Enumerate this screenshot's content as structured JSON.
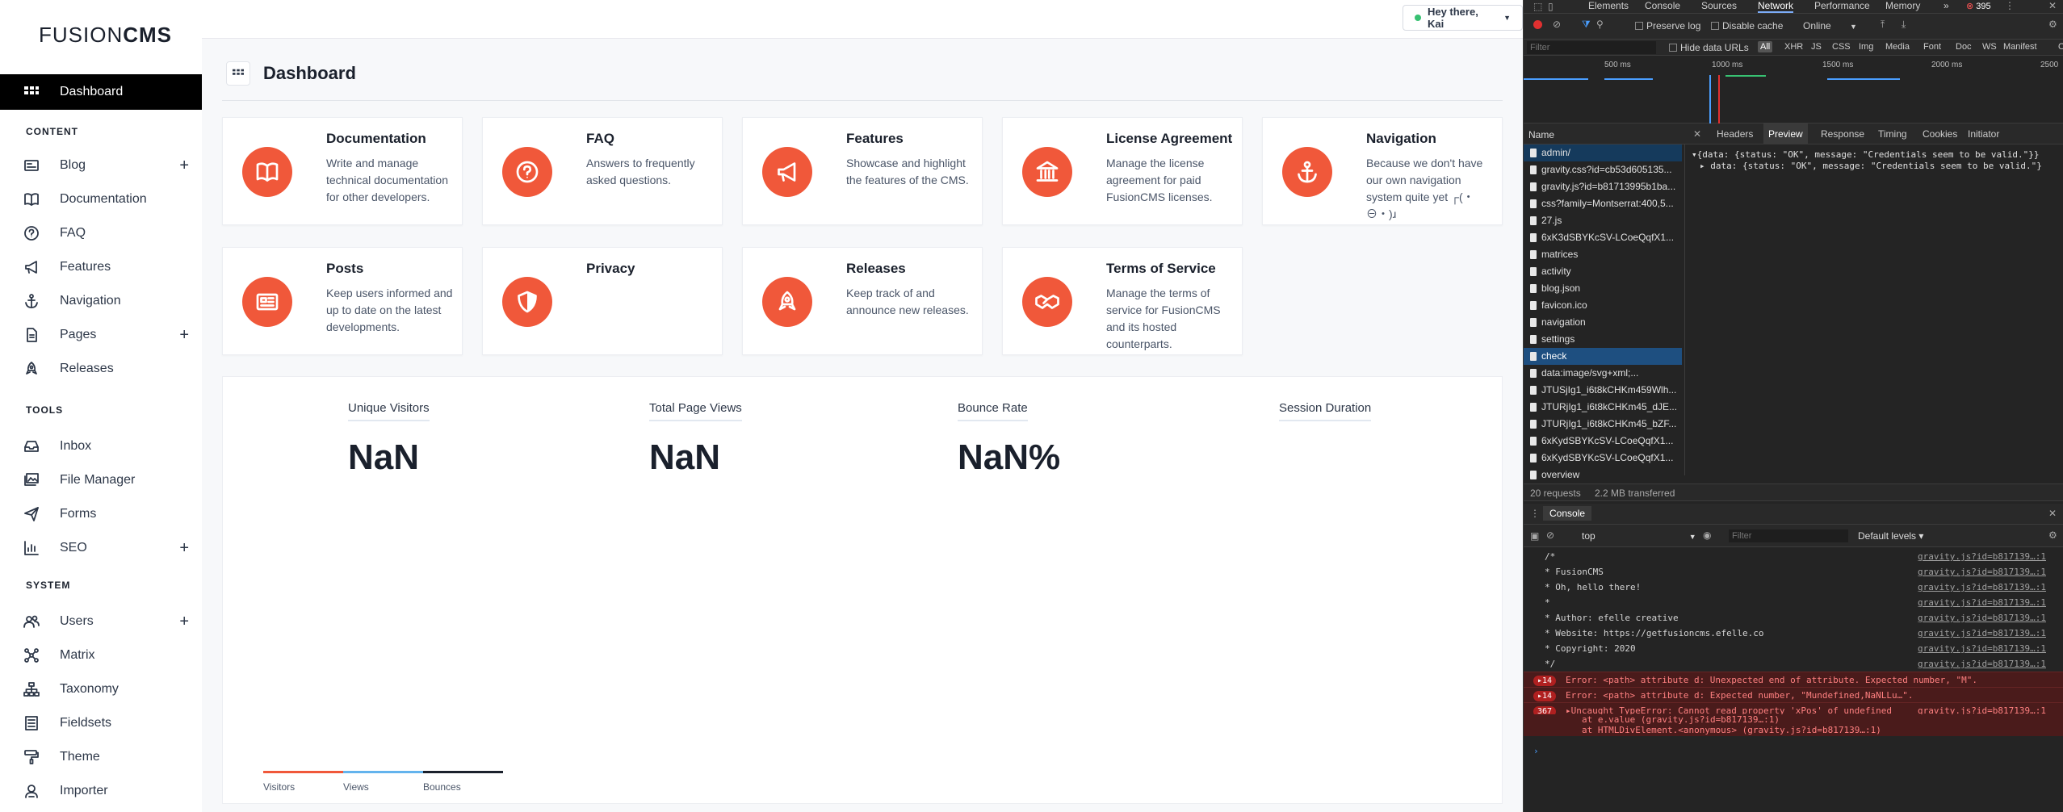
{
  "brand": {
    "part1": "FUSION",
    "part2": "CMS"
  },
  "sidebar": {
    "dashboard": "Dashboard",
    "sections": {
      "content": "CONTENT",
      "tools": "TOOLS",
      "system": "SYSTEM"
    },
    "items": [
      {
        "label": "Blog",
        "icon": "blog-icon"
      },
      {
        "label": "Documentation",
        "icon": "book-icon"
      },
      {
        "label": "FAQ",
        "icon": "question-icon"
      },
      {
        "label": "Features",
        "icon": "megaphone-icon"
      },
      {
        "label": "Navigation",
        "icon": "anchor-icon"
      },
      {
        "label": "Pages",
        "icon": "pages-icon"
      },
      {
        "label": "Releases",
        "icon": "rocket-icon"
      },
      {
        "label": "Inbox",
        "icon": "inbox-icon"
      },
      {
        "label": "File Manager",
        "icon": "images-icon"
      },
      {
        "label": "Forms",
        "icon": "paper-plane-icon"
      },
      {
        "label": "SEO",
        "icon": "chart-icon"
      },
      {
        "label": "Users",
        "icon": "users-icon"
      },
      {
        "label": "Matrix",
        "icon": "matrix-icon"
      },
      {
        "label": "Taxonomy",
        "icon": "sitemap-icon"
      },
      {
        "label": "Fieldsets",
        "icon": "list-icon"
      },
      {
        "label": "Theme",
        "icon": "paint-roller-icon"
      },
      {
        "label": "Importer",
        "icon": "importer-icon"
      }
    ],
    "plus": "+"
  },
  "topbar": {
    "greeting": "Hey there, Kai"
  },
  "page": {
    "title": "Dashboard"
  },
  "cards": [
    {
      "title": "Documentation",
      "desc": "Write and manage technical documentation for other developers.",
      "icon": "book-icon"
    },
    {
      "title": "FAQ",
      "desc": "Answers to frequently asked questions.",
      "icon": "question-icon"
    },
    {
      "title": "Features",
      "desc": "Showcase and highlight the features of the CMS.",
      "icon": "megaphone-icon"
    },
    {
      "title": "License Agreement",
      "desc": "Manage the license agreement for paid FusionCMS licenses.",
      "icon": "bank-icon"
    },
    {
      "title": "Navigation",
      "desc": "Because we don't have our own navigation system quite yet ┌(・⊖・)ɹ",
      "icon": "anchor-icon"
    },
    {
      "title": "Posts",
      "desc": "Keep users informed and up to date on the latest developments.",
      "icon": "newspaper-icon"
    },
    {
      "title": "Privacy",
      "desc": "",
      "icon": "shield-icon"
    },
    {
      "title": "Releases",
      "desc": "Keep track of and announce new releases.",
      "icon": "rocket-icon"
    },
    {
      "title": "Terms of Service",
      "desc": "Manage the terms of service for FusionCMS and its hosted counterparts.",
      "icon": "handshake-icon"
    }
  ],
  "analytics": {
    "stats": [
      {
        "label": "Unique Visitors",
        "value": "NaN"
      },
      {
        "label": "Total Page Views",
        "value": "NaN"
      },
      {
        "label": "Bounce Rate",
        "value": "NaN%"
      },
      {
        "label": "Session Duration",
        "value": ""
      }
    ],
    "legend": [
      {
        "label": "Visitors",
        "color": "#f0583a"
      },
      {
        "label": "Views",
        "color": "#63b3ed"
      },
      {
        "label": "Bounces",
        "color": "#1a202c"
      }
    ]
  },
  "colors": {
    "accent": "#f0583a",
    "sidebar_active": "#000000"
  },
  "devtools": {
    "tabs": [
      "Elements",
      "Console",
      "Sources",
      "Network",
      "Performance",
      "Memory",
      "»"
    ],
    "selected_tab": "Network",
    "error_count": "395",
    "toolbar": {
      "preserve_log": "Preserve log",
      "disable_cache": "Disable cache",
      "throttle": "Online"
    },
    "filter": {
      "placeholder": "Filter",
      "hide_data_urls": "Hide data URLs",
      "types": [
        "All",
        "XHR",
        "JS",
        "CSS",
        "Img",
        "Media",
        "Font",
        "Doc",
        "WS",
        "Manifest",
        "Other"
      ]
    },
    "timeline": [
      "500 ms",
      "1000 ms",
      "1500 ms",
      "2000 ms",
      "2500"
    ],
    "name_header": "Name",
    "detail_tabs": [
      "Headers",
      "Preview",
      "Response",
      "Timing",
      "Cookies",
      "Initiator"
    ],
    "detail_selected": "Preview",
    "preview": [
      "▾{data: {status: \"OK\", message: \"Credentials seem to be valid.\"}}",
      "▸ data: {status: \"OK\", message: \"Credentials seem to be valid.\"}"
    ],
    "requests": [
      "admin/",
      "gravity.css?id=cb53d605135...",
      "gravity.js?id=b81713995b1ba...",
      "css?family=Montserrat:400,5...",
      "27.js",
      "6xK3dSBYKcSV-LCoeQqfX1...",
      "matrices",
      "activity",
      "blog.json",
      "favicon.ico",
      "navigation",
      "settings",
      "check",
      "data:image/svg+xml;...",
      "JTUSjIg1_i6t8kCHKm459Wlh...",
      "JTURjIg1_i6t8kCHKm45_dJE...",
      "JTURjIg1_i6t8kCHKm45_bZF...",
      "6xKydSBYKcSV-LCoeQqfX1...",
      "6xKydSBYKcSV-LCoeQqfX1...",
      "overview"
    ],
    "summary": {
      "requests": "20 requests",
      "transferred": "2.2 MB transferred"
    },
    "console": {
      "title": "Console",
      "context": "top",
      "filter_placeholder": "Filter",
      "levels": "Default levels ▾",
      "lines": [
        {
          "text": "/*",
          "src": "gravity.js?id=b817139…:1"
        },
        {
          "text": " * FusionCMS",
          "src": "gravity.js?id=b817139…:1"
        },
        {
          "text": " * Oh, hello there!",
          "src": "gravity.js?id=b817139…:1"
        },
        {
          "text": " *",
          "src": "gravity.js?id=b817139…:1"
        },
        {
          "text": " * Author:    efelle creative",
          "src": "gravity.js?id=b817139…:1"
        },
        {
          "text": " * Website:   https://getfusioncms.efelle.co",
          "src": "gravity.js?id=b817139…:1"
        },
        {
          "text": " * Copyright: 2020",
          "src": "gravity.js?id=b817139…:1"
        },
        {
          "text": " */",
          "src": "gravity.js?id=b817139…:1"
        }
      ],
      "errors": [
        {
          "count": "▸14",
          "text": "Error: <path> attribute d: Unexpected end of attribute. Expected number, \"M\".",
          "src": ""
        },
        {
          "count": "▸14",
          "text": "Error: <path> attribute d: Expected number, \"Mundefined,NaNLLu…\".",
          "src": ""
        },
        {
          "count": "367",
          "text": "▸Uncaught TypeError: Cannot read property 'xPos' of undefined",
          "src": "gravity.js?id=b817139…:1"
        }
      ],
      "trace": [
        "at e.value (gravity.js?id=b817139…:1)",
        "at HTMLDivElement.<anonymous> (gravity.js?id=b817139…:1)"
      ],
      "prompt": "›"
    }
  }
}
